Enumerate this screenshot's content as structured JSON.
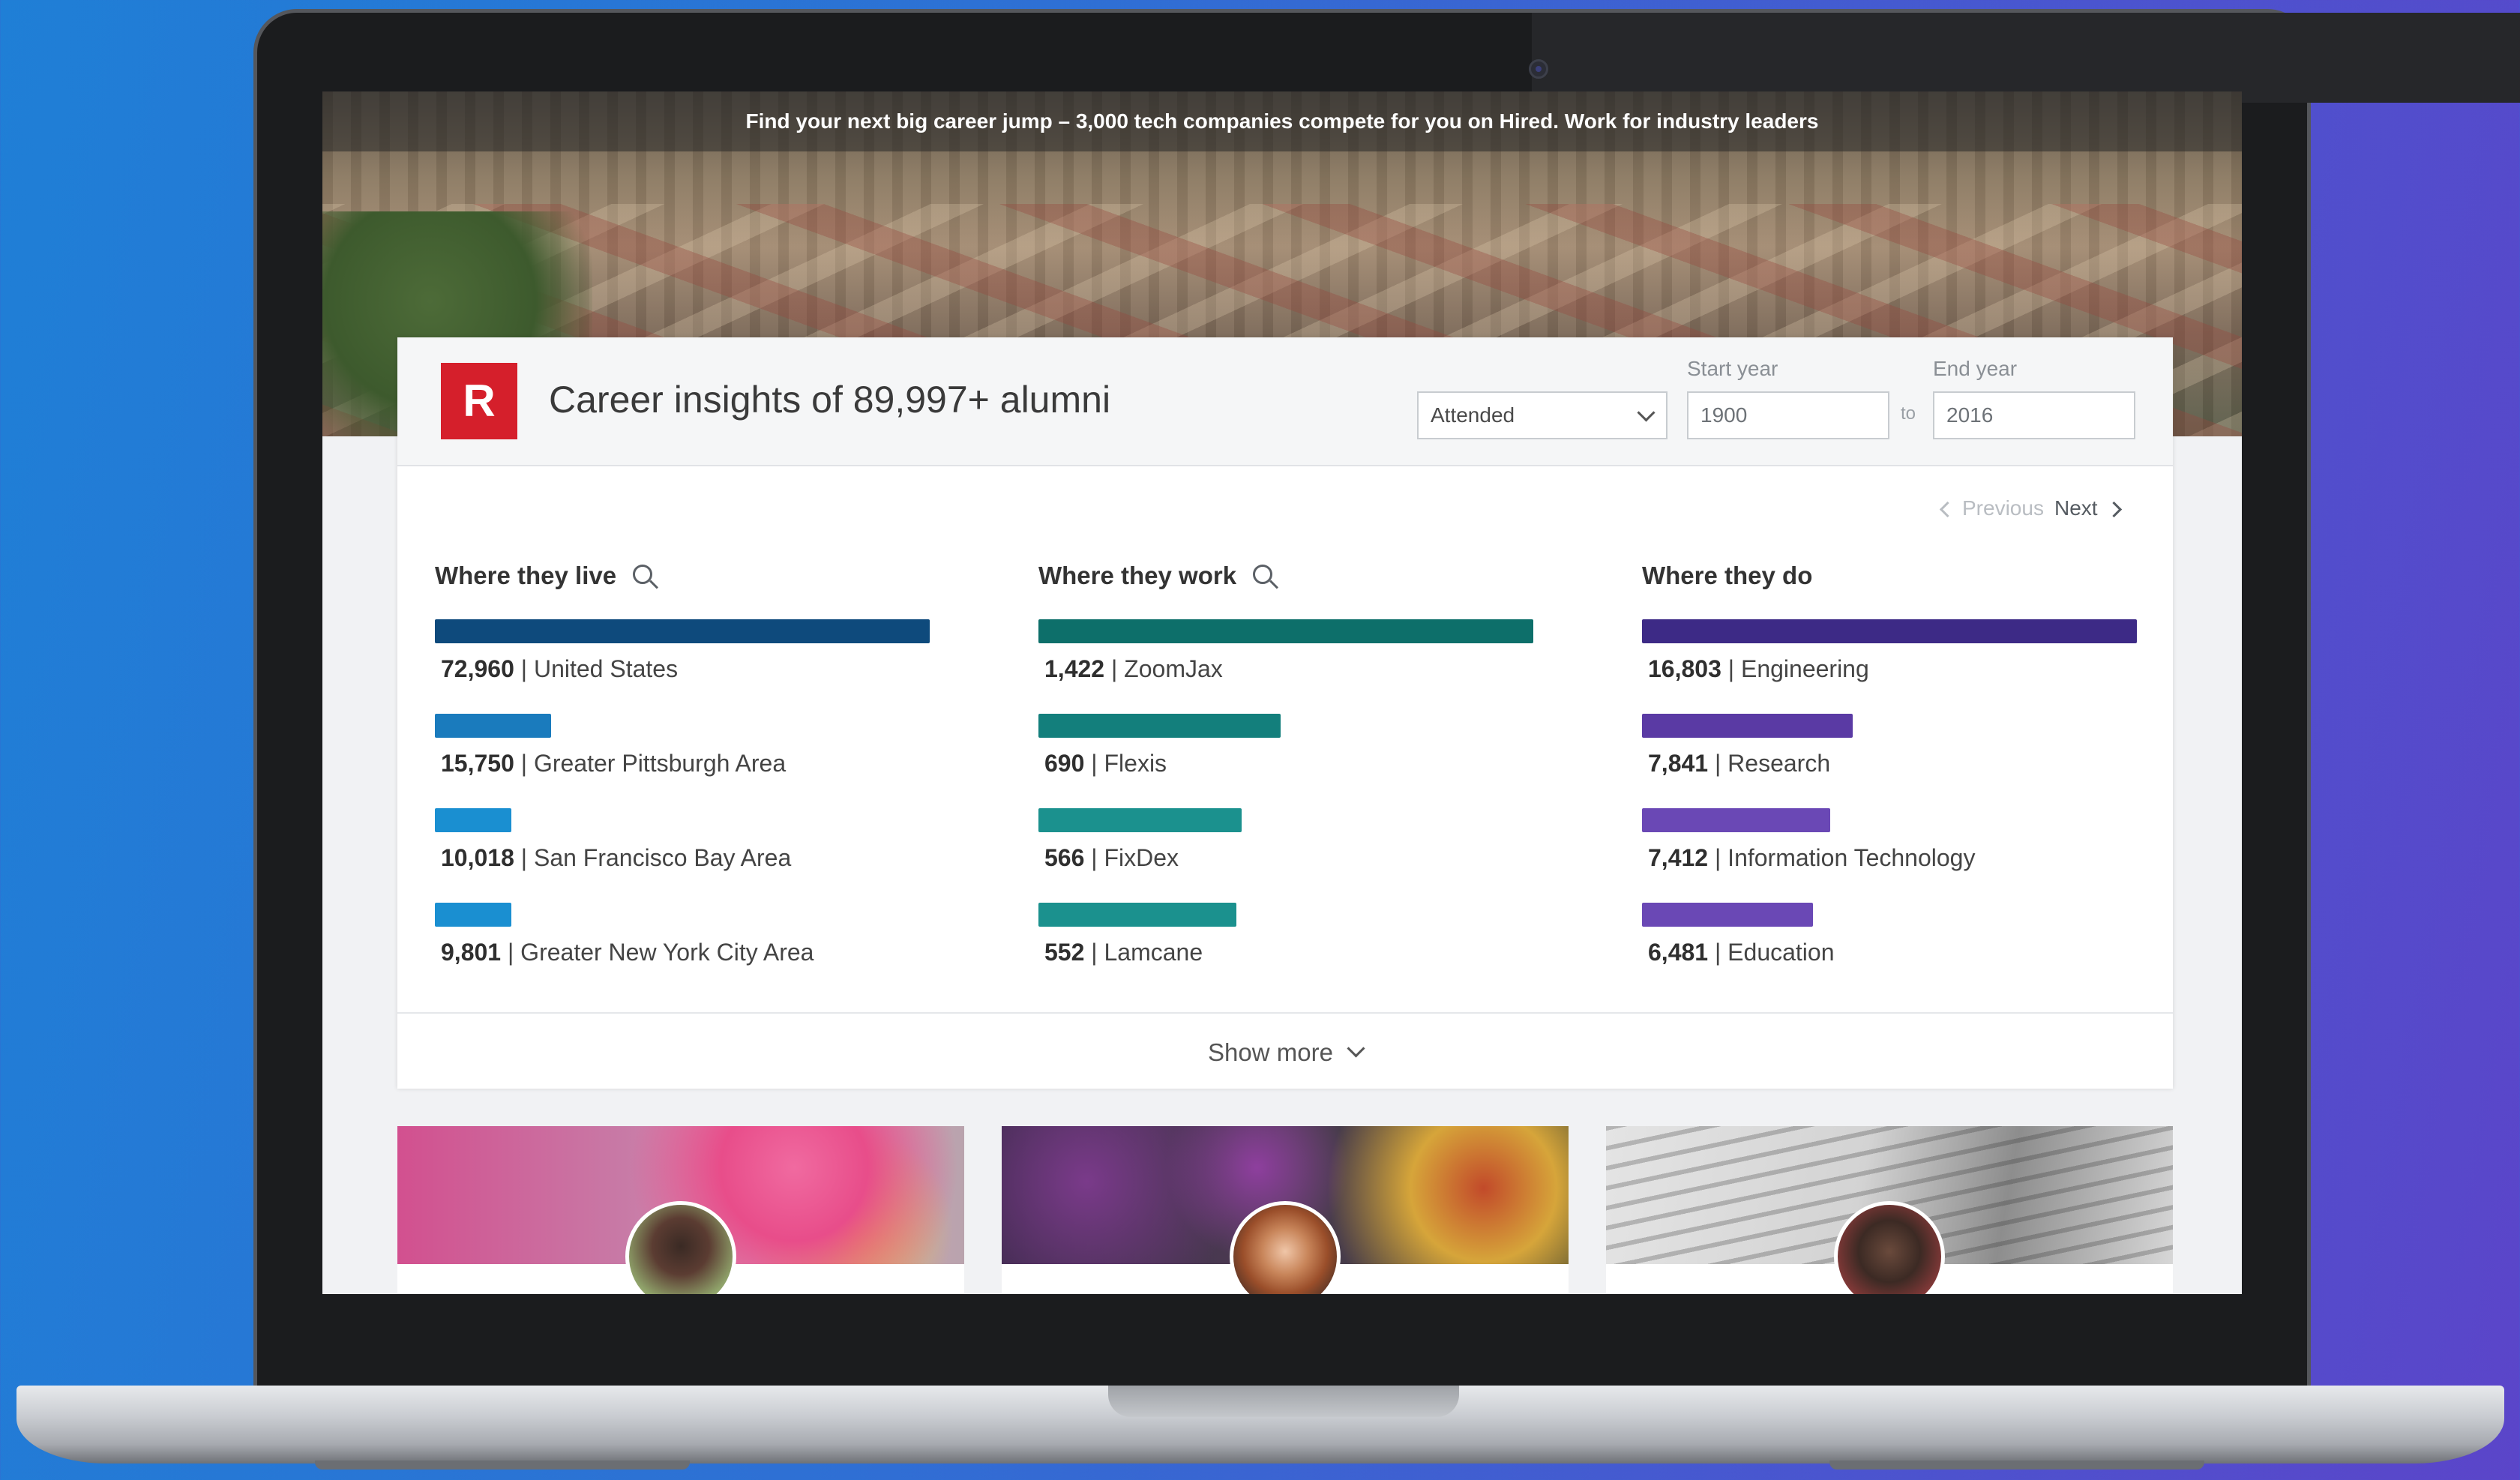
{
  "banner": {
    "text": "Find your next big career jump – 3,000 tech companies compete for you on Hired. Work for industry leaders"
  },
  "header": {
    "logo_letter": "R",
    "title": "Career insights of 89,997+ alumni",
    "select_value": "Attended",
    "start_label": "Start year",
    "start_value": "1900",
    "to_label": "to",
    "end_label": "End year",
    "end_value": "2016"
  },
  "pager": {
    "previous": "Previous",
    "next": "Next"
  },
  "columns": [
    {
      "title": "Where they live",
      "has_search": true,
      "color": "#0e4a7c",
      "items": [
        {
          "count": "72,960",
          "label": "United States",
          "share": 1.0,
          "color": "#0e4a7c"
        },
        {
          "count": "15,750",
          "label": "Greater Pittsburgh Area",
          "share": 0.235,
          "color": "#1a7bbd"
        },
        {
          "count": "10,018",
          "label": "San Francisco Bay Area",
          "share": 0.155,
          "color": "#1a8fd1"
        },
        {
          "count": "9,801",
          "label": "Greater New York City Area",
          "share": 0.155,
          "color": "#1a8fd1"
        }
      ]
    },
    {
      "title": "Where they work",
      "has_search": true,
      "items": [
        {
          "count": "1,422",
          "label": "ZoomJax",
          "share": 1.0,
          "color": "#0d6f6a"
        },
        {
          "count": "690",
          "label": "Flexis",
          "share": 0.49,
          "color": "#137f7c"
        },
        {
          "count": "566",
          "label": "FixDex",
          "share": 0.41,
          "color": "#1b918e"
        },
        {
          "count": "552",
          "label": "Lamcane",
          "share": 0.4,
          "color": "#1b918e"
        }
      ]
    },
    {
      "title": "Where they do",
      "has_search": false,
      "items": [
        {
          "count": "16,803",
          "label": "Engineering",
          "share": 1.0,
          "color": "#3d2a86"
        },
        {
          "count": "7,841",
          "label": "Research",
          "share": 0.425,
          "color": "#5a3aa4"
        },
        {
          "count": "7,412",
          "label": "Information Technology",
          "share": 0.38,
          "color": "#6a48b5"
        },
        {
          "count": "6,481",
          "label": "Education",
          "share": 0.345,
          "color": "#6a48b5"
        }
      ]
    }
  ],
  "show_more": "Show more",
  "colors": {
    "logo": "#d51f2b",
    "background_left": "#1f7fd6",
    "background_right": "#5b45c9"
  }
}
